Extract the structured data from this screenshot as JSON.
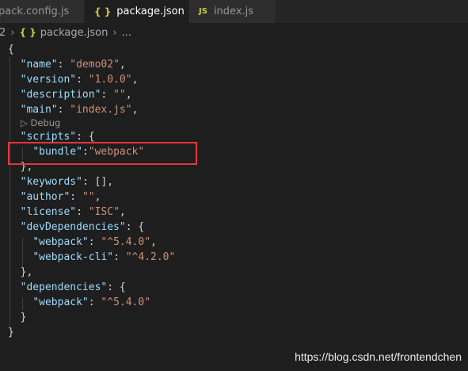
{
  "tabs": [
    {
      "label": "pack.config.js",
      "icon": "",
      "active": false
    },
    {
      "label": "package.json",
      "icon": "{ }",
      "active": true,
      "close": "×"
    },
    {
      "label": "index.js",
      "icon": "JS",
      "active": false
    }
  ],
  "breadcrumb": {
    "first": "2",
    "file_icon": "{ }",
    "file": "package.json",
    "more": "..."
  },
  "code": {
    "open_brace": "{",
    "name_key": "\"name\"",
    "name_val": "\"demo02\"",
    "version_key": "\"version\"",
    "version_val": "\"1.0.0\"",
    "description_key": "\"description\"",
    "description_val": "\"\"",
    "main_key": "\"main\"",
    "main_val": "\"index.js\"",
    "debug_lens": "Debug",
    "scripts_key": "\"scripts\"",
    "bundle_key": "\"bundle\"",
    "bundle_val": "\"webpack\"",
    "keywords_key": "\"keywords\"",
    "keywords_val": "[]",
    "author_key": "\"author\"",
    "author_val": "\"\"",
    "license_key": "\"license\"",
    "license_val": "\"ISC\"",
    "devdeps_key": "\"devDependencies\"",
    "webpack_key": "\"webpack\"",
    "webpack_val": "\"^5.4.0\"",
    "webpackcli_key": "\"webpack-cli\"",
    "webpackcli_val": "\"^4.2.0\"",
    "deps_key": "\"dependencies\"",
    "dep_webpack_key": "\"webpack\"",
    "dep_webpack_val": "\"^5.4.0\"",
    "close_brace": "}"
  },
  "watermark": "https://blog.csdn.net/frontendchen",
  "colors": {
    "key": "#9cdcfe",
    "string": "#ce9178",
    "highlight_box": "#e0373b",
    "editor_bg": "#1e1e1e"
  }
}
